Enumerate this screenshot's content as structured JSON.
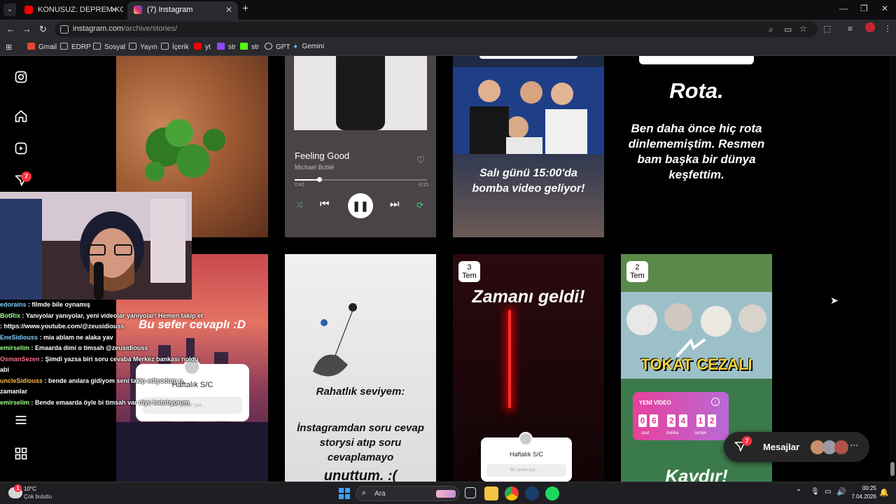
{
  "browser": {
    "tabs": [
      {
        "title": "KONUSUZ: DEPREM KORKUM, İ",
        "active": false
      },
      {
        "title": "(7) Instagram",
        "active": true
      }
    ],
    "url_domain": "instagram.com",
    "url_path": "/archive/stories/",
    "bookmarks": [
      "Gmail",
      "EDRP",
      "Sosyal",
      "Yayın",
      "İçerik",
      "yt",
      "str",
      "str",
      "GPT",
      "Gemini"
    ]
  },
  "sidebar": {
    "notification_count": "7",
    "icons": [
      "instagram-logo-icon",
      "home-icon",
      "reels-icon",
      "messages-icon",
      "menu-icon",
      "more-icon"
    ]
  },
  "stories": {
    "row1": {
      "music": {
        "song": "Feeling Good",
        "artist": "Michael Bublé",
        "elapsed": "0:42",
        "remaining": "-3:15"
      },
      "announcement": {
        "text": "Salı günü 15:00'da bomba video geliyor!"
      },
      "rota": {
        "title": "Rota.",
        "body": "Ben daha önce hiç rota dinlememiştim. Resmen bam başka bir dünya keşfettim."
      }
    },
    "row2": {
      "sunset": {
        "banner": "Bu sefer cevaplı :D",
        "question_title": "Haftalık S/C",
        "question_placeholder": "Bir şeyler yaz..."
      },
      "lamp": {
        "line1": "Rahatlık seviyem:",
        "line2": "İnstagramdan soru cevap storysi atıp soru cevaplamayo",
        "line3": "unuttum. :("
      },
      "zaman": {
        "date_day": "3",
        "date_month": "Tem",
        "text": "Zamanı geldi!",
        "question_title": "Haftalık S/C",
        "question_placeholder": "Bir şeyler yaz..."
      },
      "tokat": {
        "date_day": "2",
        "date_month": "Tem",
        "banner": "TOKAT CEZALI",
        "countdown_label": "YENİ VİDEO",
        "digits": [
          "0",
          "6",
          "2",
          "4",
          "1",
          "2"
        ],
        "units": [
          "saat",
          "dakika",
          "saniye"
        ],
        "bottom_text": "Kaydır!"
      }
    }
  },
  "chat": [
    {
      "user": "edorains",
      "msg": "filmde bile oynamış"
    },
    {
      "user": "BotRix",
      "msg": "Yanıyolar yanıyolar, yeni videolar yanıyolar! Hemen takip et : https://www.youtube.com/@zeusidiouss"
    },
    {
      "user": "EneSidiouss",
      "msg": "mia ablam ne alaka yav"
    },
    {
      "user": "emirselim",
      "msg": "Emaarda dimi o timsah @zeusidiouss"
    },
    {
      "user": "OsmanSezen",
      "msg": "Şimdi yazsa biri soru cevaba Merkez bankası noldu abi"
    },
    {
      "user": "uncleSidiouss",
      "msg": "bende anılara gidiyom seni takip ediyodum o zamanlar"
    },
    {
      "user": "emirselim",
      "msg": "Bende emaarda öyle bi timsah var diye hatırlıyorum"
    }
  ],
  "messages_pill": {
    "label": "Mesajlar",
    "count": "7"
  },
  "taskbar": {
    "weather_temp": "10°C",
    "weather_desc": "Çok bulutlu",
    "weather_badge": "1",
    "search_placeholder": "Ara",
    "time": "00:25",
    "date": "7.04.2026"
  }
}
